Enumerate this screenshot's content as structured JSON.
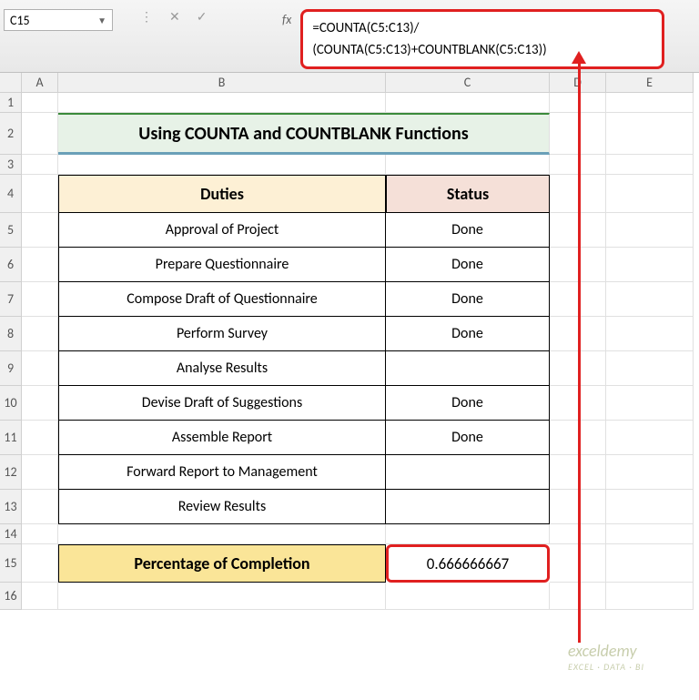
{
  "toolbar": {
    "nameBox": "C15",
    "fxLabel": "fx",
    "formula_line1": "=COUNTA(C5:C13)/",
    "formula_line2": "(COUNTA(C5:C13)+COUNTBLANK(C5:C13))"
  },
  "columns": [
    "A",
    "B",
    "C",
    "D",
    "E"
  ],
  "rowNumbers": [
    "1",
    "2",
    "3",
    "4",
    "5",
    "6",
    "7",
    "8",
    "9",
    "10",
    "11",
    "12",
    "13",
    "14",
    "15",
    "16"
  ],
  "title": "Using COUNTA and COUNTBLANK Functions",
  "headers": {
    "duties": "Duties",
    "status": "Status"
  },
  "rows": [
    {
      "duty": "Approval of Project",
      "status": "Done"
    },
    {
      "duty": "Prepare Questionnaire",
      "status": "Done"
    },
    {
      "duty": "Compose Draft of Questionnaire",
      "status": "Done"
    },
    {
      "duty": "Perform Survey",
      "status": "Done"
    },
    {
      "duty": "Analyse Results",
      "status": ""
    },
    {
      "duty": "Devise Draft of Suggestions",
      "status": "Done"
    },
    {
      "duty": "Assemble Report",
      "status": "Done"
    },
    {
      "duty": "Forward Report to Management",
      "status": ""
    },
    {
      "duty": "Review Results",
      "status": ""
    }
  ],
  "footer": {
    "label": "Percentage of Completion",
    "value": "0.666666667"
  },
  "watermark": {
    "brand": "exceldemy",
    "tag": "EXCEL · DATA · BI"
  }
}
